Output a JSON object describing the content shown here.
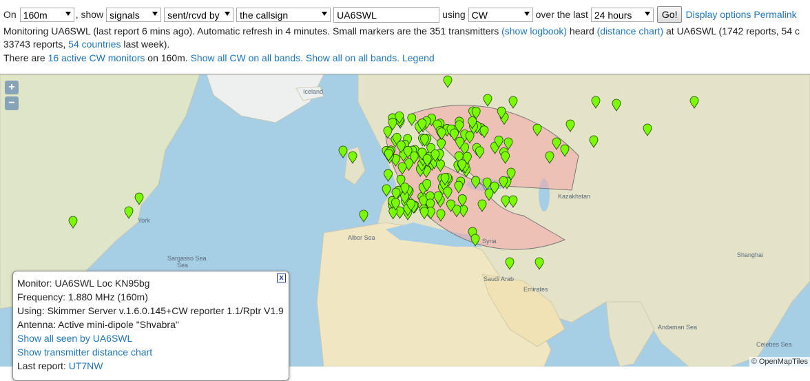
{
  "toolbar": {
    "on_label": "On",
    "band": "160m",
    "show_label": ", show",
    "show_what": "signals",
    "direction": "sent/rcvd by",
    "target": "the callsign",
    "callsign": "UA6SWL",
    "using_label": "using",
    "mode": "CW",
    "over_label": "over the last",
    "period": "24 hours",
    "go_label": "Go!",
    "display_options": "Display options",
    "permalink": "Permalink"
  },
  "status": {
    "line1_a": "Monitoring UA6SWL (last report 6 mins ago). Automatic refresh in 4 minutes. Small markers are the 351 transmitters ",
    "show_logbook": "(show logbook)",
    "line1_b": " heard ",
    "distance_chart": "(distance chart)",
    "line1_c": " at UA6SWL (1742 reports, 54 c",
    "line2_a": "33743 reports, ",
    "countries": "54 countries",
    "line2_b": " last week).",
    "line3_a": "There are ",
    "active_monitors": "16 active CW monitors",
    "line3_b": " on 160m. ",
    "show_all_cw": "Show all CW on all bands.",
    "show_all": "Show all on all bands.",
    "legend": "Legend"
  },
  "map": {
    "zoom_in": "+",
    "zoom_out": "−",
    "attribution": "© OpenMapTiles",
    "labels": [
      "Iceland",
      "York",
      "Sargasso Sea",
      "Albor Sea",
      "Saudi Arab",
      "Emirates",
      "Andaman Sea",
      "Celebes Sea",
      "Shanghai",
      "Kazakhstan",
      "Syria",
      "Sea"
    ],
    "marker_color": "#7cfc00",
    "zone_color": "#f4a6a6"
  },
  "popup": {
    "monitor": "Monitor: UA6SWL Loc KN95bg",
    "frequency": "Frequency: 1.880 MHz (160m)",
    "using": "Using: Skimmer Server v.1.6.0.145+CW reporter 1.1/Rptr V1.9",
    "antenna": "Antenna: Active mini-dipole \"Shvabra\"",
    "show_seen": "Show all seen by UA6SWL",
    "show_distance": "Show transmitter distance chart",
    "last_report_label": "Last report: ",
    "last_report_call": "UT7NW",
    "close": "x"
  }
}
